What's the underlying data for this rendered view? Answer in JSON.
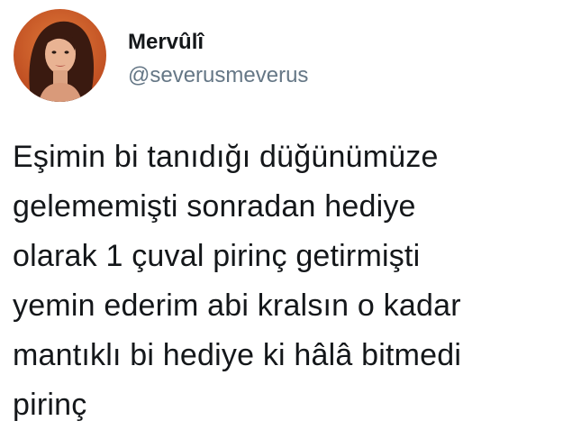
{
  "user": {
    "display_name": "Mervûlî",
    "handle": "@severusmeverus",
    "avatar_icon": "profile-photo-avatar"
  },
  "tweet": {
    "lines": [
      "Eşimin bi tanıdığı düğünümüze",
      "gelememişti sonradan hediye",
      "olarak 1 çuval pirinç getirmişti",
      "yemin ederim abi kralsın o kadar",
      "mantıklı bi hediye ki hâlâ bitmedi",
      "pirinç"
    ]
  },
  "colors": {
    "text": "#14171a",
    "handle": "#657786",
    "background": "#ffffff"
  }
}
